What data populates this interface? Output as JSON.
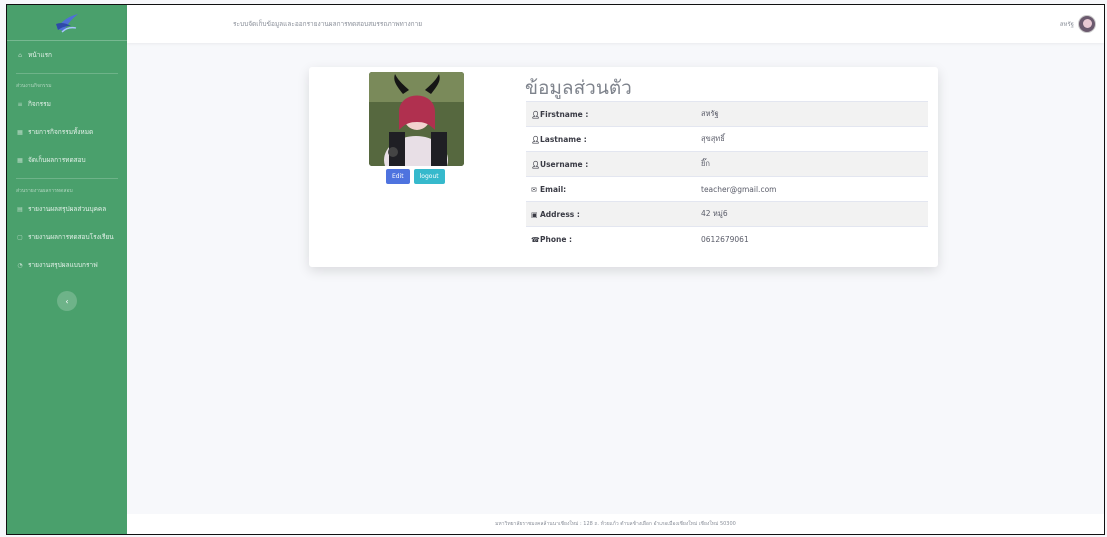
{
  "sidebar": {
    "items": [
      {
        "label": "หน้าแรก",
        "icon": "home-icon"
      },
      {
        "heading": "ส่วนงานกิจกรรม"
      },
      {
        "label": "กิจกรรม",
        "icon": "list-icon"
      },
      {
        "label": "รายการกิจกรรมทั้งหมด",
        "icon": "table-icon"
      },
      {
        "label": "จัดเก็บผลการทดสอบ",
        "icon": "table-icon"
      },
      {
        "heading": "ส่วนรายงานผลการทดสอบ"
      },
      {
        "label": "รายงานผลสรุปผลส่วนบุคคล",
        "icon": "file-icon"
      },
      {
        "label": "รายงานผลการทดสอบโรงเรียน",
        "icon": "file-icon"
      },
      {
        "label": "รายงานสรุปผลแบบกราฟ",
        "icon": "chart-icon"
      }
    ]
  },
  "topbar": {
    "title": "ระบบจัดเก็บข้อมูลและออกรายงานผลการทดสอบสมรรถภาพทางกาย",
    "user_name": "สหรัฐ"
  },
  "profile": {
    "title": "ข้อมูลส่วนตัว",
    "edit_label": "Edit",
    "logout_label": "logout",
    "rows": [
      {
        "icon": "user-icon",
        "label": "Firstname :",
        "value": "สหรัฐ"
      },
      {
        "icon": "user-icon",
        "label": "Lastname :",
        "value": "สุขสุทธิ์"
      },
      {
        "icon": "user-tie-icon",
        "label": "Username :",
        "value": "ยิ๊ก"
      },
      {
        "icon": "envelope-icon",
        "label": "Email:",
        "value": "teacher@gmail.com"
      },
      {
        "icon": "address-card-icon",
        "label": "Address :",
        "value": "42 หมู่6"
      },
      {
        "icon": "phone-icon",
        "label": "Phone :",
        "value": "0612679061"
      }
    ]
  },
  "footer": {
    "text": "มหาวิทยาลัยราชมงคลล้านนาเชียงใหม่ : 128 ถ. ห้วยแก้ว ตำบลช้างเผือก อำเภอเมืองเชียงใหม่ เชียงใหม่ 50300"
  },
  "colors": {
    "sidebar": "#4aa06c",
    "edit_button": "#4e73df",
    "logout_button": "#36b9cc"
  }
}
